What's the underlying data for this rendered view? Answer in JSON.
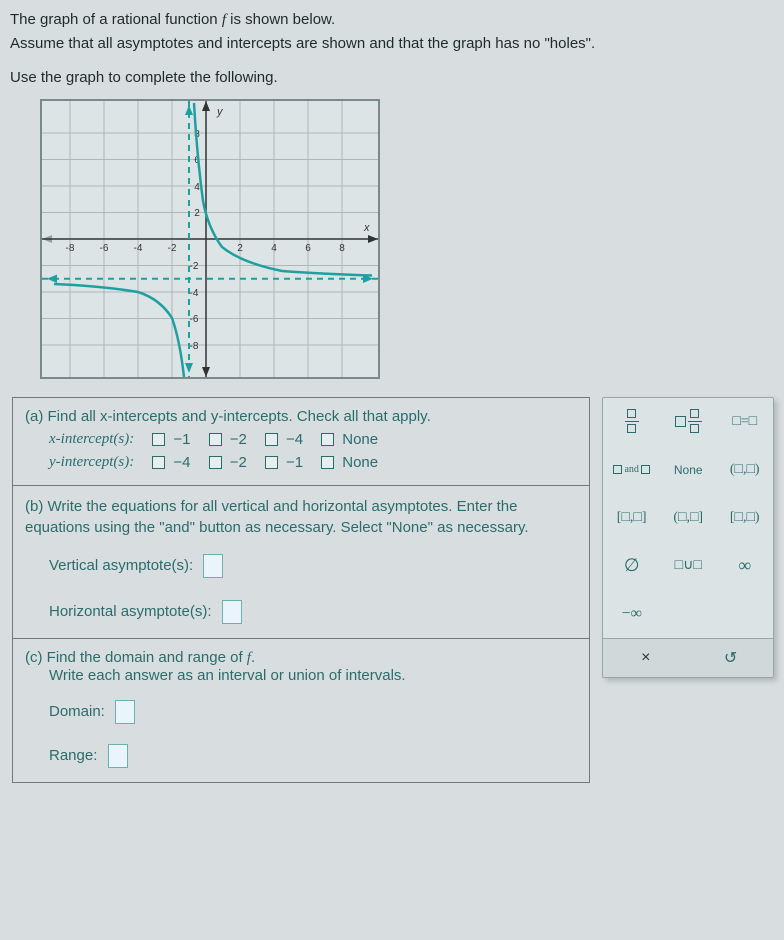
{
  "intro": {
    "l1a": "The graph of a rational function ",
    "l1b": " is shown below.",
    "l2": "Assume that all asymptotes and intercepts are shown and that the graph has no \"holes\".",
    "l3": "Use the graph to complete the following.",
    "f": "f"
  },
  "partA": {
    "prompt": "(a) Find all x-intercepts and y-intercepts. Check all that apply.",
    "x_label": "x-intercept(s):",
    "y_label": "y-intercept(s):",
    "x_opts": [
      "−1",
      "−2",
      "−4",
      "None"
    ],
    "y_opts": [
      "−4",
      "−2",
      "−1",
      "None"
    ]
  },
  "partB": {
    "prompt": "(b) Write the equations for all vertical and horizontal asymptotes. Enter the equations using the \"and\" button as necessary. Select \"None\" as necessary.",
    "v_label": "Vertical asymptote(s):",
    "h_label": "Horizontal asymptote(s):"
  },
  "partC": {
    "prompt1": "(c) Find the domain and range of ",
    "f": "f",
    "prompt2": ".",
    "sub": "Write each answer as an interval or union of intervals.",
    "d": "Domain:",
    "r": "Range:"
  },
  "palette": {
    "and": "and",
    "none": "None",
    "open": "(□,□)",
    "cc": "[□,□]",
    "oc": "(□,□]",
    "co": "[□,□)",
    "empty": "∅",
    "union": "□∪□",
    "inf": "∞",
    "ninf": "−∞",
    "eq": "□=□",
    "close": "×",
    "reset": "↺"
  },
  "chart_data": {
    "type": "line",
    "title": "",
    "xlabel": "x",
    "ylabel": "y",
    "xlim": [
      -8,
      8
    ],
    "ylim": [
      -8,
      8
    ],
    "vertical_asymptote": -1,
    "horizontal_asymptote": -3,
    "series": [
      {
        "name": "left-branch",
        "x": [
          -8,
          -6,
          -4,
          -3,
          -2,
          -1.7,
          -1.4,
          -1.2,
          -1.1
        ],
        "y": [
          -3.4,
          -3.6,
          -4.0,
          -4.5,
          -6.0,
          -7.3,
          -10,
          -16,
          -30
        ]
      },
      {
        "name": "right-branch",
        "x": [
          -0.9,
          -0.8,
          -0.6,
          -0.3,
          0,
          0.5,
          1,
          2,
          4,
          6,
          8
        ],
        "y": [
          30,
          16,
          8,
          3.3,
          0,
          -0.9,
          -1.5,
          -2.0,
          -2.4,
          -2.6,
          -2.7
        ]
      }
    ]
  },
  "axis_ticks": {
    "x": [
      -8,
      -6,
      -4,
      -2,
      2,
      4,
      6,
      8
    ],
    "y": [
      -8,
      -6,
      -4,
      -2,
      2,
      4,
      6,
      8
    ]
  }
}
